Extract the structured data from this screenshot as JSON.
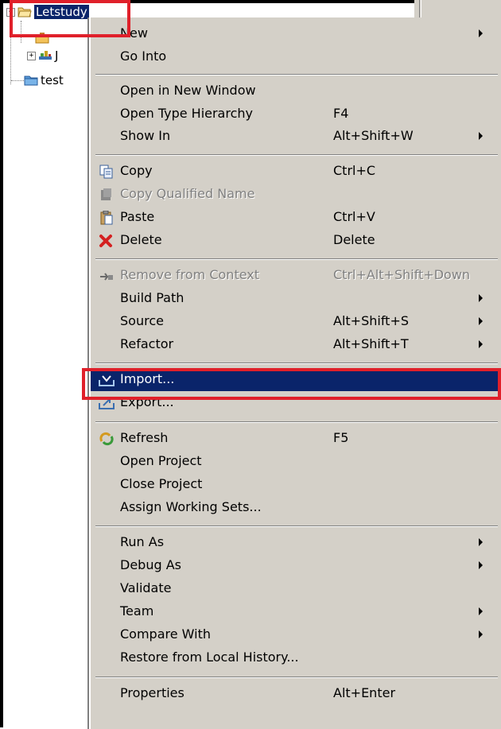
{
  "tree": {
    "project_label": "Letstudy",
    "sub_item_1": "J",
    "sub_item_2": "test"
  },
  "menu": {
    "items": [
      {
        "label": "New",
        "accel": "",
        "submenu": true
      },
      {
        "label": "Go Into",
        "accel": "",
        "submenu": false
      },
      {
        "label": "Open in New Window",
        "accel": "",
        "submenu": false
      },
      {
        "label": "Open Type Hierarchy",
        "accel": "F4",
        "submenu": false
      },
      {
        "label": "Show In",
        "accel": "Alt+Shift+W",
        "submenu": true
      },
      {
        "label": "Copy",
        "accel": "Ctrl+C",
        "submenu": false
      },
      {
        "label": "Copy Qualified Name",
        "accel": "",
        "submenu": false
      },
      {
        "label": "Paste",
        "accel": "Ctrl+V",
        "submenu": false
      },
      {
        "label": "Delete",
        "accel": "Delete",
        "submenu": false
      },
      {
        "label": "Remove from Context",
        "accel": "Ctrl+Alt+Shift+Down",
        "submenu": false
      },
      {
        "label": "Build Path",
        "accel": "",
        "submenu": true
      },
      {
        "label": "Source",
        "accel": "Alt+Shift+S",
        "submenu": true
      },
      {
        "label": "Refactor",
        "accel": "Alt+Shift+T",
        "submenu": true
      },
      {
        "label": "Import...",
        "accel": "",
        "submenu": false
      },
      {
        "label": "Export...",
        "accel": "",
        "submenu": false
      },
      {
        "label": "Refresh",
        "accel": "F5",
        "submenu": false
      },
      {
        "label": "Open Project",
        "accel": "",
        "submenu": false
      },
      {
        "label": "Close Project",
        "accel": "",
        "submenu": false
      },
      {
        "label": "Assign Working Sets...",
        "accel": "",
        "submenu": false
      },
      {
        "label": "Run As",
        "accel": "",
        "submenu": true
      },
      {
        "label": "Debug As",
        "accel": "",
        "submenu": true
      },
      {
        "label": "Validate",
        "accel": "",
        "submenu": false
      },
      {
        "label": "Team",
        "accel": "",
        "submenu": true
      },
      {
        "label": "Compare With",
        "accel": "",
        "submenu": true
      },
      {
        "label": "Restore from Local History...",
        "accel": "",
        "submenu": false
      },
      {
        "label": "Properties",
        "accel": "Alt+Enter",
        "submenu": false
      }
    ]
  },
  "colors": {
    "highlight_bg": "#0a246a",
    "menu_bg": "#d4d0c8",
    "annotation_red": "#e0202a"
  }
}
